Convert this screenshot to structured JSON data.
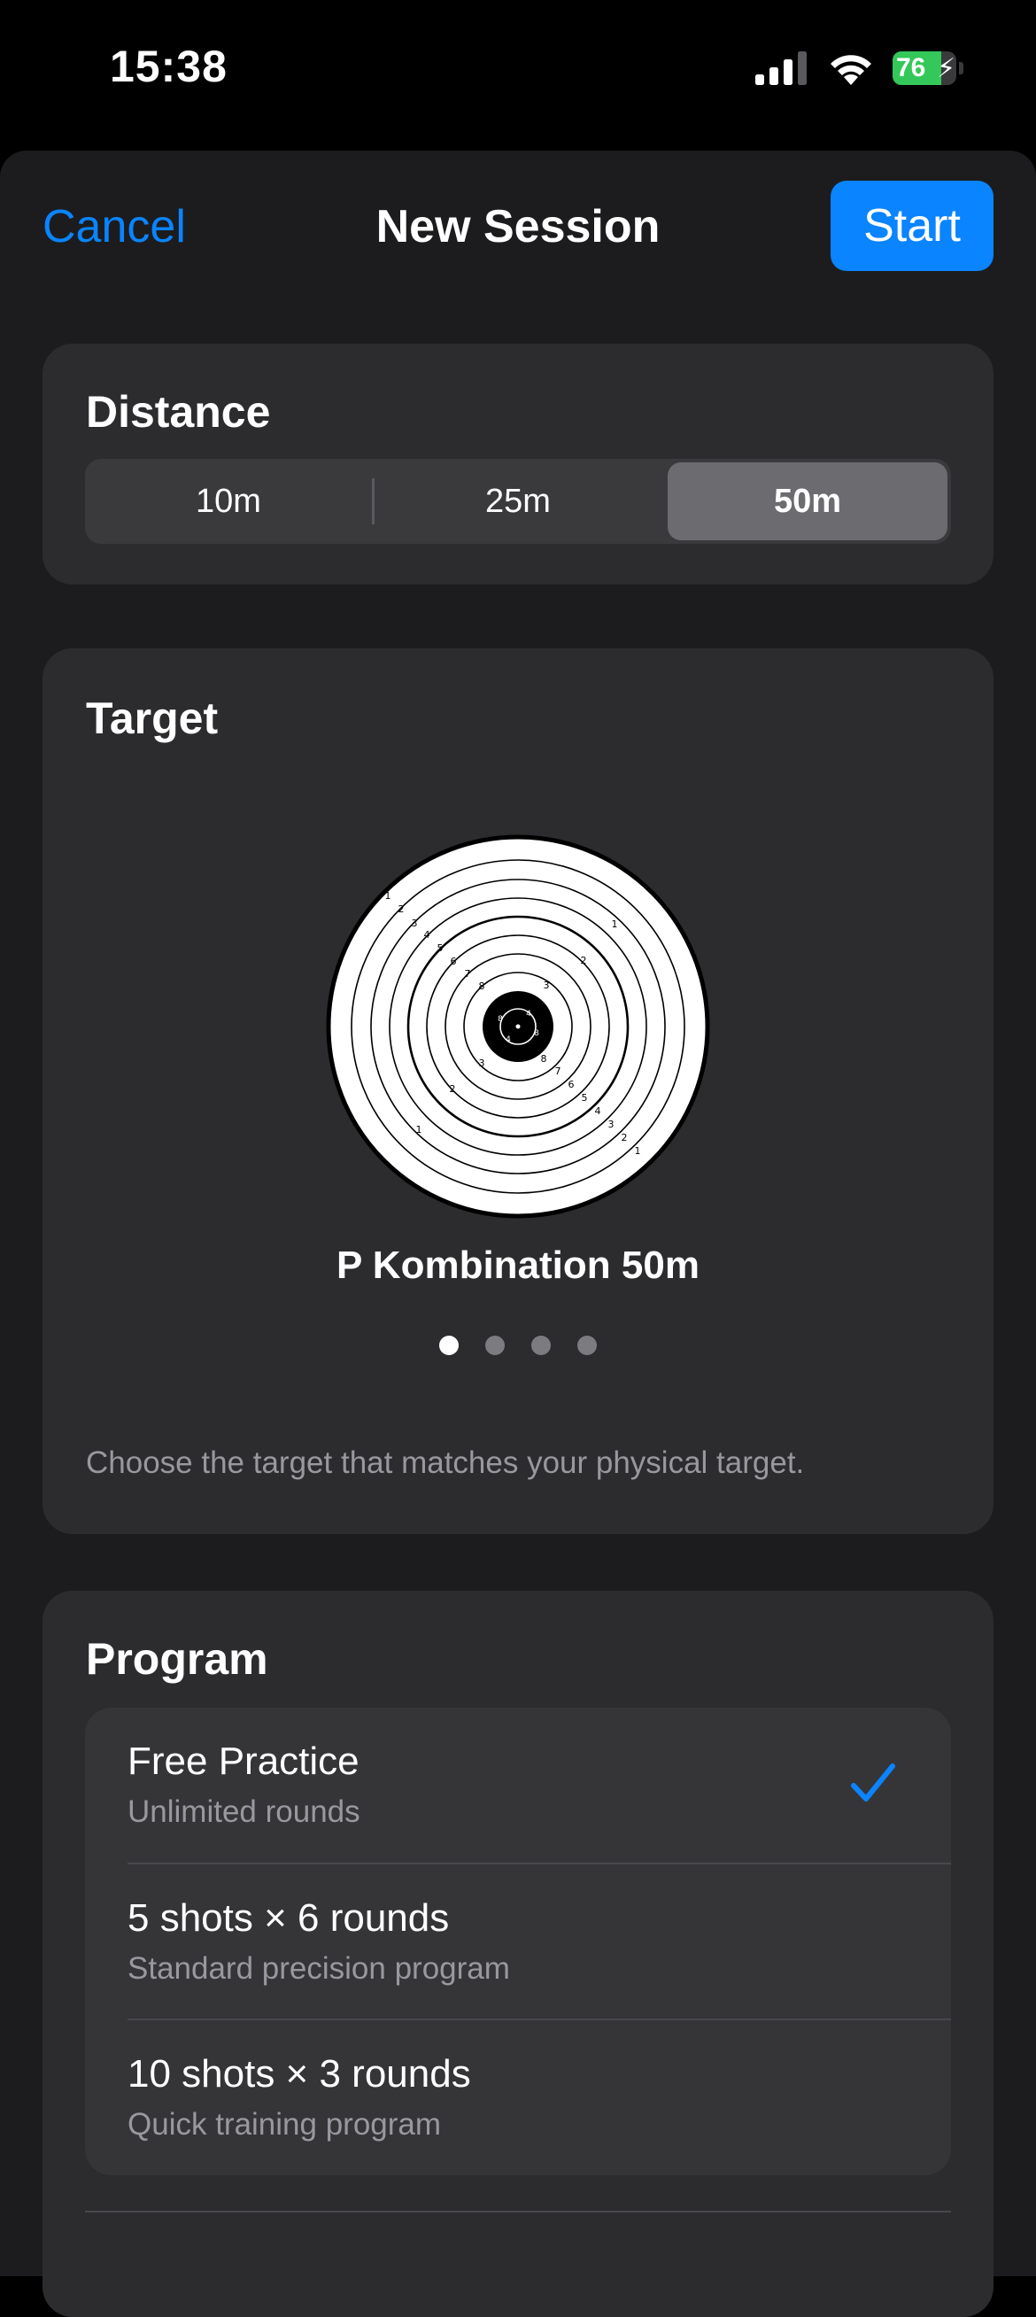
{
  "status_bar": {
    "time": "15:38",
    "battery_percent": "76",
    "battery_level": 0.76,
    "icons": [
      "cellular-signal-icon",
      "wifi-icon",
      "battery-charging-icon"
    ]
  },
  "nav": {
    "cancel_label": "Cancel",
    "title": "New Session",
    "start_label": "Start"
  },
  "distance": {
    "title": "Distance",
    "options": [
      "10m",
      "25m",
      "50m"
    ],
    "selected": "50m"
  },
  "target": {
    "title": "Target",
    "name": "P Kombination 50m",
    "page_count": 4,
    "current_page": 1,
    "hint": "Choose the target that matches your physical target."
  },
  "program": {
    "title": "Program",
    "items": [
      {
        "title": "Free Practice",
        "subtitle": "Unlimited rounds",
        "selected": true
      },
      {
        "title": "5 shots × 6 rounds",
        "subtitle": "Standard precision program",
        "selected": false
      },
      {
        "title": "10 shots × 3 rounds",
        "subtitle": "Quick training program",
        "selected": false
      }
    ]
  },
  "colors": {
    "accent": "#0a84ff",
    "sheet_background": "#1c1c1e",
    "card_background": "#2c2c2e",
    "battery_green": "#34c759"
  }
}
